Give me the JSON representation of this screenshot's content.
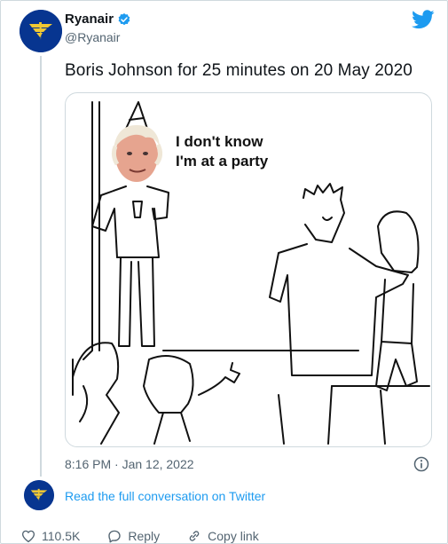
{
  "account": {
    "name": "Ryanair",
    "handle": "@Ryanair"
  },
  "tweet": {
    "text": "Boris Johnson for 25 minutes on 20 May 2020",
    "image_caption": "I don't know\nI'm at a party",
    "image_caption_line1": "I don't know",
    "image_caption_line2": "I'm at a party",
    "timestamp": "8:16 PM · Jan 12, 2022"
  },
  "conversation_link": "Read the full conversation on Twitter",
  "actions": {
    "like_count": "110.5K",
    "reply_label": "Reply",
    "copy_link_label": "Copy link"
  },
  "colors": {
    "brand_blue": "#073590",
    "brand_yellow": "#f1c933",
    "twitter_blue": "#1d9bf0",
    "muted_text": "#536471"
  },
  "icons": [
    "ryanair-logo-icon",
    "verified-badge-icon",
    "twitter-bird-icon",
    "info-icon",
    "heart-icon",
    "reply-icon",
    "link-icon"
  ]
}
